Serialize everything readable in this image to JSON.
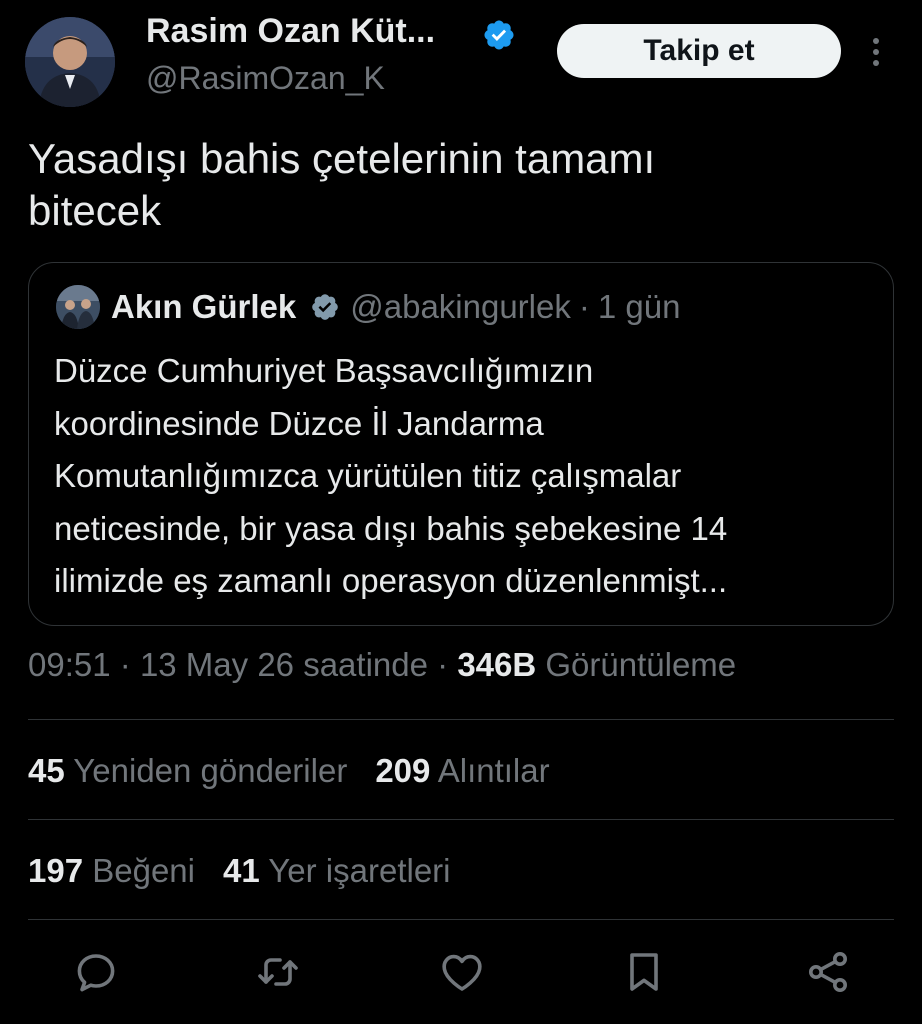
{
  "tweet": {
    "author": {
      "name": "Rasim Ozan Küt...",
      "handle": "@RasimOzan_K",
      "verified": true
    },
    "follow_button": "Takip et",
    "text_lines": [
      "Yasadışı bahis çetelerinin tamamı",
      "bitecek"
    ]
  },
  "quote": {
    "author_name": "Akın Gürlek",
    "handle": "@abakingurlek",
    "separator": "·",
    "time": "1 gün",
    "text_lines": [
      "Düzce Cumhuriyet Başsavcılığımızın",
      "koordinesinde Düzce İl Jandarma",
      "Komutanlığımızca yürütülen titiz çalışmalar",
      "neticesinde, bir yasa dışı bahis şebekesine 14",
      "ilimizde eş zamanlı operasyon düzenlenmişt..."
    ]
  },
  "meta": {
    "time": "09:51",
    "sep": "·",
    "date": "13 May 26 saatinde",
    "views_count": "346B",
    "views_label": "Görüntüleme"
  },
  "stats": {
    "reposts_count": "45",
    "reposts_label": "Yeniden gönderiler",
    "quotes_count": "209",
    "quotes_label": "Alıntılar",
    "likes_count": "197",
    "likes_label": "Beğeni",
    "bookmarks_count": "41",
    "bookmarks_label": "Yer işaretleri"
  },
  "actions": [
    "reply-icon",
    "repost-icon",
    "like-icon",
    "bookmark-icon",
    "share-icon"
  ],
  "colors": {
    "background": "#000000",
    "text": "#e7e9ea",
    "secondary": "#71767b",
    "verified": "#1d9bf0",
    "border": "#2f3336",
    "follow_bg": "#eff3f4"
  }
}
